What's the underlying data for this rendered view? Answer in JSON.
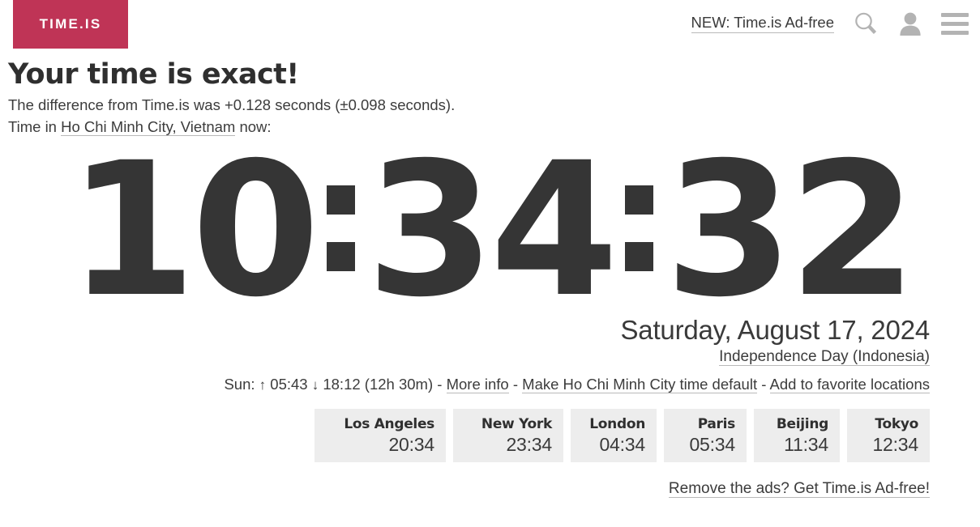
{
  "header": {
    "logo_text": "TIME.IS",
    "logo_color": "#bf3456",
    "nav_link_label": "NEW: Time.is Ad-free",
    "icons": {
      "search": "search-icon",
      "account": "person-icon",
      "menu": "hamburger-menu-icon"
    }
  },
  "main": {
    "title": "Your time is exact!",
    "difference_text": "The difference from Time.is was +0.128 seconds (±0.098 seconds).",
    "time_in_prefix": "Time in ",
    "location_link": "Ho Chi Minh City, Vietnam",
    "time_in_suffix": " now:"
  },
  "clock": {
    "hours": "10",
    "minutes": "34",
    "seconds": "32",
    "full": "10:34:32",
    "digit_color": "#353535"
  },
  "date": {
    "full_date": "Saturday, August 17, 2024",
    "holiday": "Independence Day (Indonesia)"
  },
  "sun": {
    "label": "Sun:",
    "sunrise_arrow": "↑",
    "sunrise": "05:43",
    "sunset_arrow": "↓",
    "sunset": "18:12",
    "day_length": "(12h 30m)",
    "separator": "-",
    "more_info_link": "More info",
    "make_default_link": "Make Ho Chi Minh City time default",
    "add_favorite_link": "Add to favorite locations"
  },
  "cities": [
    {
      "name": "Los Angeles",
      "time": "20:34"
    },
    {
      "name": "New York",
      "time": "23:34"
    },
    {
      "name": "London",
      "time": "04:34"
    },
    {
      "name": "Paris",
      "time": "05:34"
    },
    {
      "name": "Beijing",
      "time": "11:34"
    },
    {
      "name": "Tokyo",
      "time": "12:34"
    }
  ],
  "footer": {
    "remove_ads_link": "Remove the ads? Get Time.is Ad-free!"
  }
}
